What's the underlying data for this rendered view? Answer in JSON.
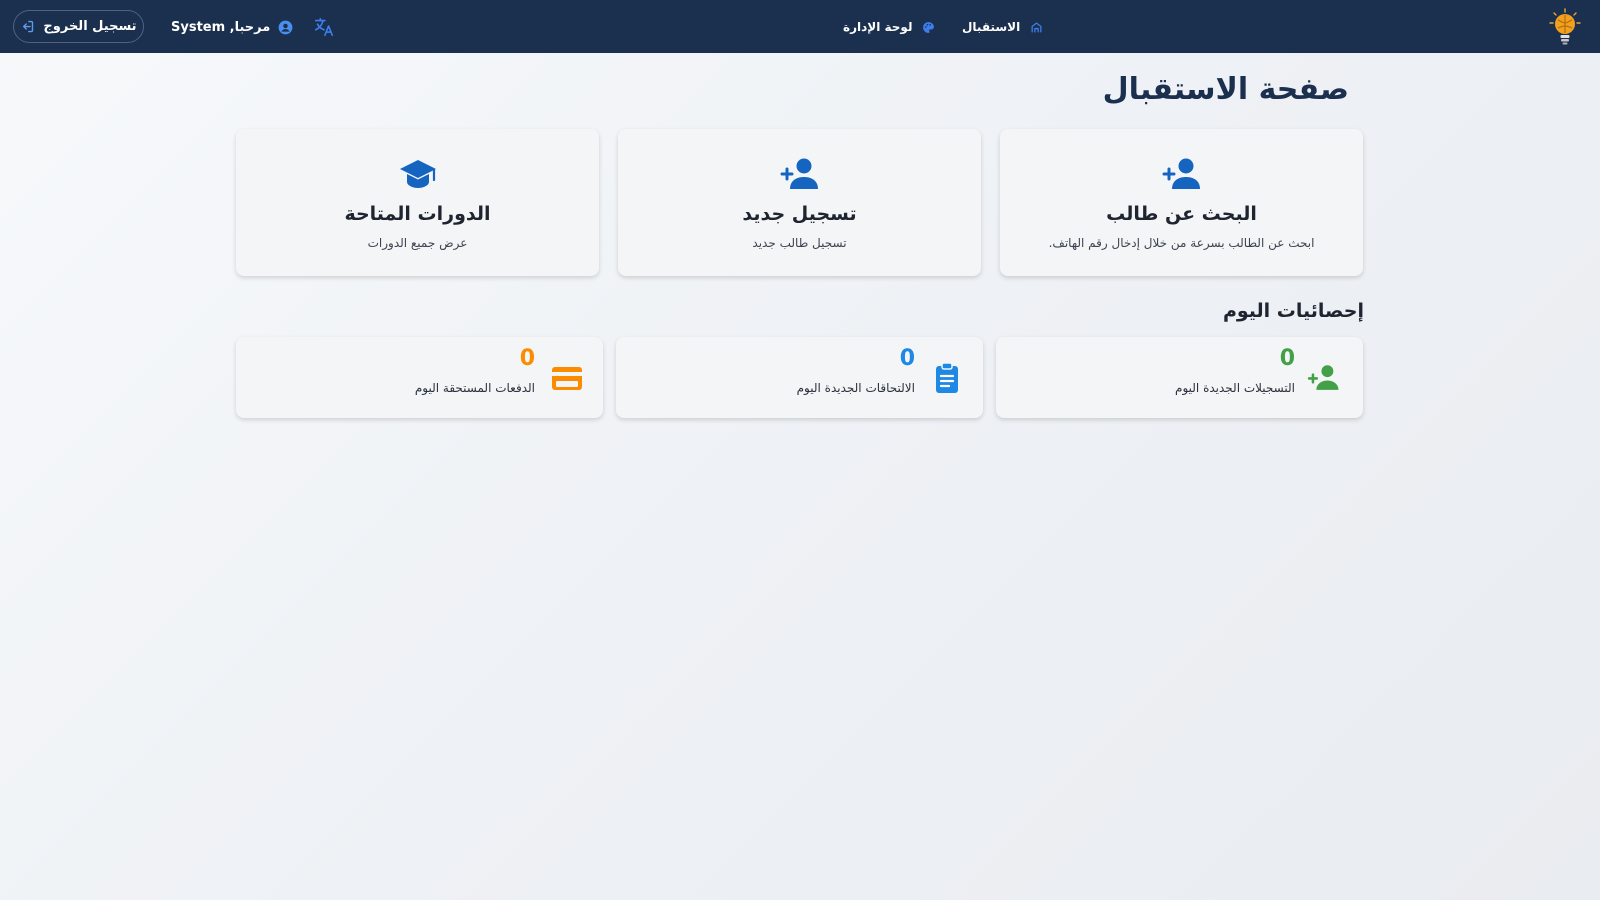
{
  "topbar": {
    "logout_label": "تسجيل الخروج",
    "welcome_label": "مرحبا, System",
    "nav": [
      {
        "label": "الاستقبال",
        "icon": "home-icon"
      },
      {
        "label": "لوحة الإدارة",
        "icon": "palette-icon"
      }
    ],
    "translate_icon": "translate-icon",
    "logo_icon": "lightbulb-brain-logo"
  },
  "page": {
    "title": "صفحة الاستقبال"
  },
  "action_cards": [
    {
      "title": "البحث عن طالب",
      "description": "ابحث عن الطالب بسرعة من خلال إدخال رقم الهاتف.",
      "icon": "person-add-icon"
    },
    {
      "title": "تسجيل جديد",
      "description": "تسجيل طالب جديد",
      "icon": "person-add-icon"
    },
    {
      "title": "الدورات المتاحة",
      "description": "عرض جميع الدورات",
      "icon": "graduation-cap-icon"
    }
  ],
  "stats": {
    "title": "إحصائيات اليوم",
    "items": [
      {
        "value": "0",
        "label": "التسجيلات الجديدة اليوم",
        "icon": "person-add-icon",
        "color": "#43a047"
      },
      {
        "value": "0",
        "label": "الالتحاقات الجديدة اليوم",
        "icon": "clipboard-icon",
        "color": "#1e88e5"
      },
      {
        "value": "0",
        "label": "الدفعات المستحقة اليوم",
        "icon": "credit-card-icon",
        "color": "#fb8c00"
      }
    ]
  },
  "colors": {
    "topbar": "#1b2f4e",
    "primary_icon": "#1565c0",
    "accent_blue": "#3d7eea"
  }
}
